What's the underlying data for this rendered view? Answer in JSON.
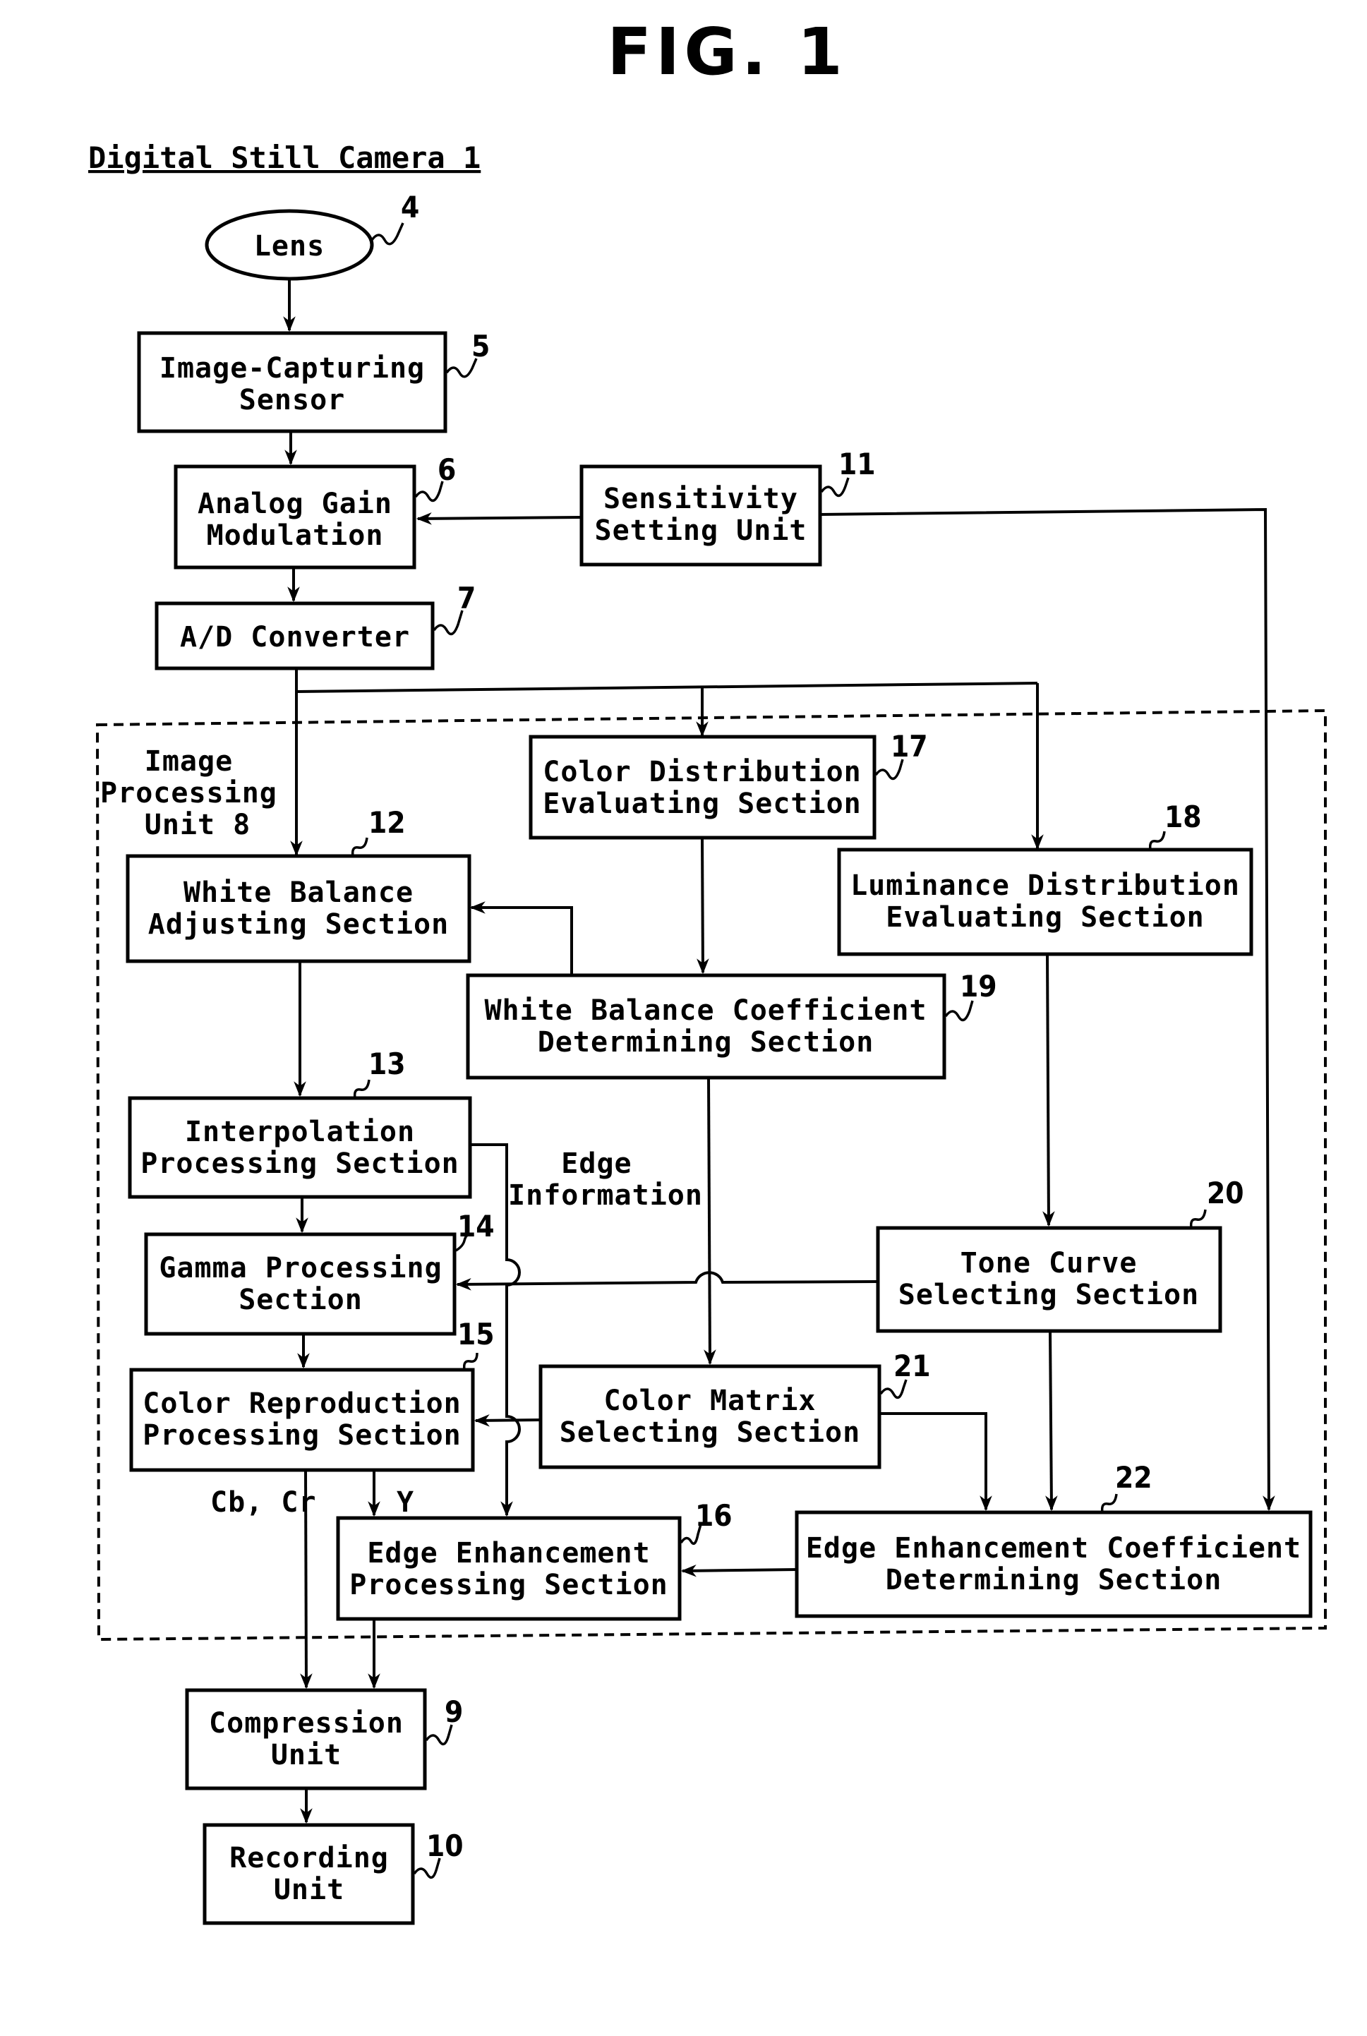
{
  "figure": {
    "title": "FIG. 1",
    "caption": "Digital Still Camera 1",
    "group_label": [
      "Image",
      "Processing",
      "Unit 8"
    ]
  },
  "blocks": {
    "lens": {
      "ref": "4",
      "lines": [
        "Lens"
      ]
    },
    "sensor": {
      "ref": "5",
      "lines": [
        "Image-Capturing",
        "Sensor"
      ]
    },
    "analog_gain": {
      "ref": "6",
      "lines": [
        "Analog Gain",
        "Modulation"
      ]
    },
    "ad_converter": {
      "ref": "7",
      "lines": [
        "A/D Converter"
      ]
    },
    "compression": {
      "ref": "9",
      "lines": [
        "Compression",
        "Unit"
      ]
    },
    "recording": {
      "ref": "10",
      "lines": [
        "Recording",
        "Unit"
      ]
    },
    "sensitivity": {
      "ref": "11",
      "lines": [
        "Sensitivity",
        "Setting Unit"
      ]
    },
    "wb_adjust": {
      "ref": "12",
      "lines": [
        "White Balance",
        "Adjusting Section"
      ]
    },
    "interpolation": {
      "ref": "13",
      "lines": [
        "Interpolation",
        "Processing Section"
      ]
    },
    "gamma": {
      "ref": "14",
      "lines": [
        "Gamma Processing",
        "Section"
      ]
    },
    "color_repro": {
      "ref": "15",
      "lines": [
        "Color Reproduction",
        "Processing Section"
      ]
    },
    "edge_proc": {
      "ref": "16",
      "lines": [
        "Edge Enhancement",
        "Processing Section"
      ]
    },
    "color_dist": {
      "ref": "17",
      "lines": [
        "Color Distribution",
        "Evaluating Section"
      ]
    },
    "lum_dist": {
      "ref": "18",
      "lines": [
        "Luminance Distribution",
        "Evaluating Section"
      ]
    },
    "wb_coef": {
      "ref": "19",
      "lines": [
        "White Balance Coefficient",
        "Determining Section"
      ]
    },
    "tone_curve": {
      "ref": "20",
      "lines": [
        "Tone Curve",
        "Selecting Section"
      ]
    },
    "color_matrix": {
      "ref": "21",
      "lines": [
        "Color Matrix",
        "Selecting Section"
      ]
    },
    "edge_coef": {
      "ref": "22",
      "lines": [
        "Edge Enhancement Coefficient",
        "Determining Section"
      ]
    }
  },
  "annotations": {
    "edge_info": [
      "Edge",
      "Information"
    ],
    "chroma": "Cb, Cr",
    "luma": "Y"
  }
}
